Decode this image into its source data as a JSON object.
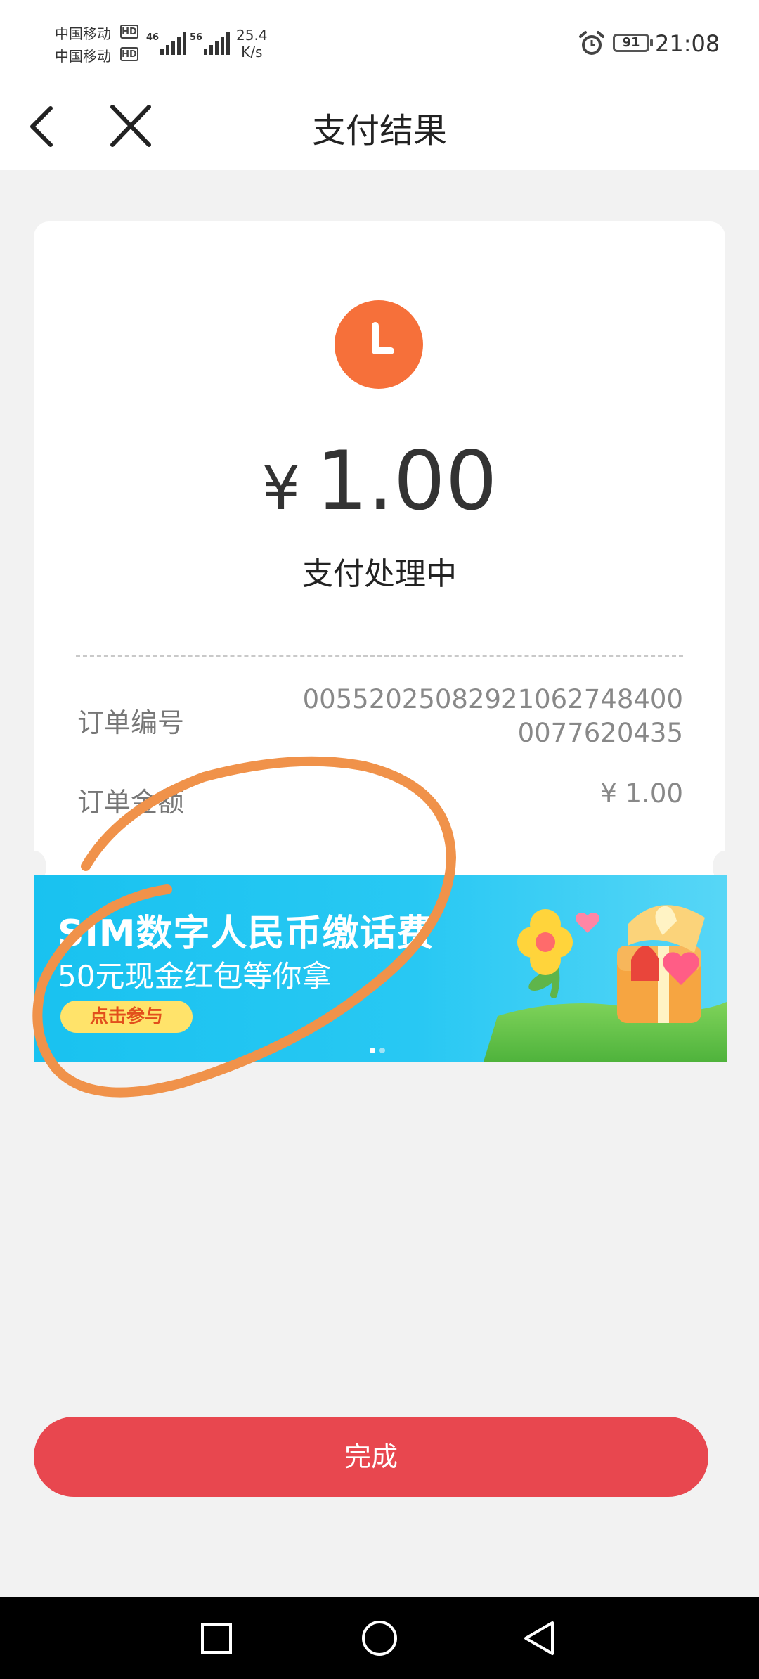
{
  "status_bar": {
    "carrier1": "中国移动",
    "carrier2": "中国移动",
    "hd": "HD",
    "sig1_tag": "46",
    "sig2_tag": "56",
    "speed_value": "25.4",
    "speed_unit": "K/s",
    "battery": "91",
    "time": "21:08"
  },
  "nav": {
    "title": "支付结果"
  },
  "result": {
    "currency": "¥",
    "amount": "1.00",
    "status": "支付处理中",
    "order_no_label": "订单编号",
    "order_no_line1": "00552025082921062748400",
    "order_no_line2": "0077620435",
    "order_amount_label": "订单金额",
    "order_amount_value": "¥ 1.00"
  },
  "banner": {
    "title": "SIM数字人民币缴话费",
    "subtitle": "50元现金红包等你拿",
    "button": "点击参与",
    "active_dot_color": "#ffffff",
    "inactive_dot_color": "#9fe3f6"
  },
  "footer": {
    "done_button": "完成"
  },
  "colors": {
    "accent": "#e8474f",
    "clock": "#f6703a",
    "annotation_stroke": "#f0924a"
  }
}
